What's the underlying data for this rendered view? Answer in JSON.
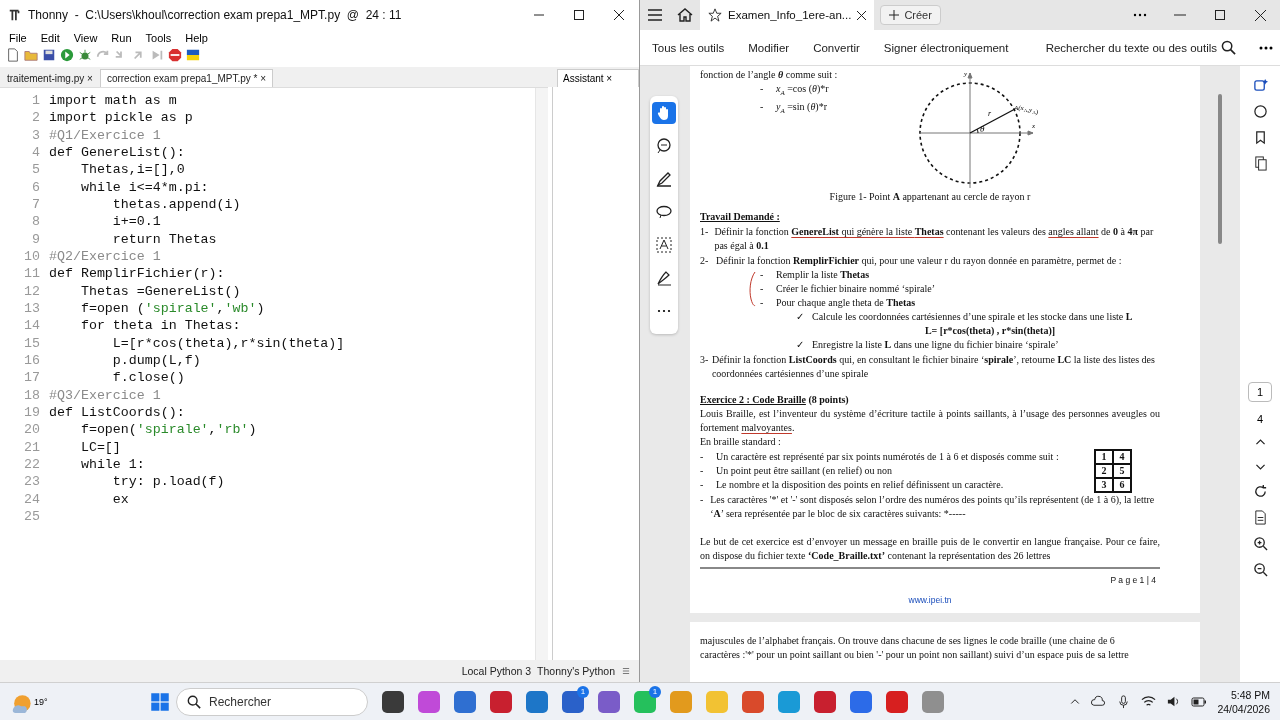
{
  "thonny": {
    "title": "Thonny  -  C:\\Users\\khoul\\correction exam prepa1_MPT.py  @  24 : 11",
    "menu": [
      "File",
      "Edit",
      "View",
      "Run",
      "Tools",
      "Help"
    ],
    "tabs": [
      {
        "label": "traitement-img.py",
        "close": "×",
        "selected": false
      },
      {
        "label": "correction exam prepa1_MPT.py *",
        "close": "×",
        "selected": true
      }
    ],
    "assistant_tab": {
      "label": "Assistant",
      "close": "×"
    },
    "code": [
      {
        "number": "1",
        "parts": [
          {
            "text": "import math as m",
            "kind": "plain"
          }
        ]
      },
      {
        "number": "2",
        "parts": [
          {
            "text": "import pickle as p",
            "kind": "plain"
          }
        ]
      },
      {
        "number": "3",
        "parts": [
          {
            "text": "#Q1/Exercice 1",
            "kind": "comment"
          }
        ]
      },
      {
        "number": "4",
        "parts": [
          {
            "text": "def GenereList():",
            "kind": "plain"
          }
        ]
      },
      {
        "number": "5",
        "parts": [
          {
            "text": "    Thetas,i=[],0",
            "kind": "plain"
          }
        ]
      },
      {
        "number": "6",
        "parts": [
          {
            "text": "    while i<=4*m.pi:",
            "kind": "plain"
          }
        ]
      },
      {
        "number": "7",
        "parts": [
          {
            "text": "        thetas.append(i)",
            "kind": "plain"
          }
        ]
      },
      {
        "number": "8",
        "parts": [
          {
            "text": "        i+=0.1",
            "kind": "plain"
          }
        ]
      },
      {
        "number": "9",
        "parts": [
          {
            "text": "        return Thetas",
            "kind": "plain"
          }
        ]
      },
      {
        "number": "10",
        "parts": [
          {
            "text": "#Q2/Exercice 1",
            "kind": "comment"
          }
        ]
      },
      {
        "number": "11",
        "parts": [
          {
            "text": "def RemplirFichier(r):",
            "kind": "plain"
          }
        ]
      },
      {
        "number": "12",
        "parts": [
          {
            "text": "    Thetas =GenereList()",
            "kind": "plain"
          }
        ]
      },
      {
        "number": "13",
        "parts": [
          {
            "text": "    f=open (",
            "kind": "plain"
          },
          {
            "text": "'spirale'",
            "kind": "string"
          },
          {
            "text": ",",
            "kind": "plain"
          },
          {
            "text": "'wb'",
            "kind": "string"
          },
          {
            "text": ")",
            "kind": "plain"
          }
        ]
      },
      {
        "number": "14",
        "parts": [
          {
            "text": "    for theta in Thetas:",
            "kind": "plain"
          }
        ]
      },
      {
        "number": "15",
        "parts": [
          {
            "text": "        L=[r*cos(theta),r*sin(theta)]",
            "kind": "plain"
          }
        ]
      },
      {
        "number": "16",
        "parts": [
          {
            "text": "        p.dump(L,f)",
            "kind": "plain"
          }
        ]
      },
      {
        "number": "17",
        "parts": [
          {
            "text": "        f.close()",
            "kind": "plain"
          }
        ]
      },
      {
        "number": "18",
        "parts": [
          {
            "text": "#Q3/Exercice 1",
            "kind": "comment"
          }
        ]
      },
      {
        "number": "19",
        "parts": [
          {
            "text": "def ListCoords():",
            "kind": "plain"
          }
        ]
      },
      {
        "number": "20",
        "parts": [
          {
            "text": "    f=open(",
            "kind": "plain"
          },
          {
            "text": "'spirale'",
            "kind": "string"
          },
          {
            "text": ",",
            "kind": "plain"
          },
          {
            "text": "'rb'",
            "kind": "string"
          },
          {
            "text": ")",
            "kind": "plain"
          }
        ]
      },
      {
        "number": "21",
        "parts": [
          {
            "text": "    LC=[]",
            "kind": "plain"
          }
        ]
      },
      {
        "number": "22",
        "parts": [
          {
            "text": "    while 1:",
            "kind": "plain"
          }
        ]
      },
      {
        "number": "23",
        "parts": [
          {
            "text": "        try: p.load(f)",
            "kind": "plain"
          }
        ]
      },
      {
        "number": "24",
        "parts": [
          {
            "text": "        ex",
            "kind": "plain"
          }
        ]
      },
      {
        "number": "25"
      }
    ],
    "status": [
      "Local Python 3",
      "Thonny's Python"
    ]
  },
  "reader": {
    "tab_title": "Examen_Info_1ere-an...",
    "create_button": "Créer",
    "tools": [
      "Tous les outils",
      "Modifier",
      "Convertir",
      "Signer électroniquement"
    ],
    "search": "Rechercher du texte ou des outils",
    "page": {
      "intro": [
        {
          "kind": "para",
          "parts": [
            {
              "text": "fonction de l’angle "
            },
            {
              "text": "θ",
              "kind": "bold-italic"
            },
            {
              "text": " comme suit :"
            }
          ]
        },
        {
          "kind": "sub-dash",
          "mark": "-",
          "parts": [
            {
              "text": "x",
              "kind": "italic"
            },
            {
              "text": "A",
              "kind": "sub"
            },
            {
              "text": " =cos ("
            },
            {
              "text": "θ",
              "kind": "italic"
            },
            {
              "text": ")*r"
            }
          ]
        },
        {
          "kind": "sub-dash",
          "mark": "-",
          "parts": [
            {
              "text": "y",
              "kind": "italic"
            },
            {
              "text": "A",
              "kind": "sub"
            },
            {
              "text": " =sin ("
            },
            {
              "text": "θ",
              "kind": "italic"
            },
            {
              "text": ")*r"
            }
          ]
        }
      ],
      "figure": {
        "y_axis": "y",
        "x_axis": "x",
        "radius": "r",
        "angle": "θ",
        "point": [
          {
            "text": "A(x",
            "kind": "italic"
          },
          {
            "text": "A",
            "kind": "sub"
          },
          {
            "text": ",y",
            "kind": "italic"
          },
          {
            "text": "A",
            "kind": "sub"
          },
          {
            "text": ")",
            "kind": "italic"
          }
        ],
        "caption": [
          {
            "text": "Figure 1- Point "
          },
          {
            "text": "A",
            "kind": "bold"
          },
          {
            "text": " appartenant au cercle de rayon r"
          }
        ]
      },
      "blocks": [
        {
          "kind": "heading",
          "parts": [
            {
              "text": "Travail Demandé :",
              "kind": "heading"
            }
          ]
        },
        {
          "kind": "numbered",
          "mark": "1-",
          "parts": [
            {
              "text": "Définir la fonction "
            },
            {
              "text": "GenereList",
              "kind": "bold-ink"
            },
            {
              "text": " qui génère la liste ",
              "kind": "ink"
            },
            {
              "text": "Thetas",
              "kind": "bold-ink"
            },
            {
              "text": " contenant les valeurs des "
            },
            {
              "text": "angles allant",
              "kind": "ink"
            },
            {
              "text": " de "
            },
            {
              "text": "0",
              "kind": "bold"
            },
            {
              "text": " à "
            },
            {
              "text": "4π",
              "kind": "bold"
            },
            {
              "text": " par pas égal à "
            },
            {
              "text": "0.1",
              "kind": "bold"
            }
          ]
        },
        {
          "kind": "numbered",
          "mark": "2-",
          "parts": [
            {
              "text": "Définir la fonction "
            },
            {
              "text": "RemplirFichier",
              "kind": "bold"
            },
            {
              "text": " qui, pour une valeur r du rayon donnée en paramètre, permet de :"
            }
          ]
        },
        {
          "kind": "sub-dash",
          "mark": "-",
          "parts": [
            {
              "text": "Remplir la liste "
            },
            {
              "text": "Thetas",
              "kind": "bold"
            }
          ]
        },
        {
          "kind": "sub-dash",
          "mark": "-",
          "parts": [
            {
              "text": "Créer le fichier binaire nommé ‘spirale’"
            }
          ]
        },
        {
          "kind": "sub-dash",
          "mark": "-",
          "parts": [
            {
              "text": "Pour chaque angle theta de "
            },
            {
              "text": "Thetas",
              "kind": "bold"
            }
          ]
        },
        {
          "kind": "check",
          "mark": "✓",
          "parts": [
            {
              "text": "Calcule les coordonnées cartésiennes d’une spirale et les stocke dans une liste "
            },
            {
              "text": "L",
              "kind": "bold"
            }
          ]
        },
        {
          "kind": "formula",
          "parts": [
            {
              "text": "L= [r*cos(theta) , r*sin(theta)]",
              "kind": "bold"
            }
          ]
        },
        {
          "kind": "check",
          "mark": "✓",
          "parts": [
            {
              "text": "Enregistre la liste "
            },
            {
              "text": "L",
              "kind": "bold"
            },
            {
              "text": " dans une ligne du fichier binaire ‘spirale’"
            }
          ]
        },
        {
          "kind": "numbered",
          "mark": "3-",
          "parts": [
            {
              "text": "Définir la fonction "
            },
            {
              "text": "ListCoords",
              "kind": "bold"
            },
            {
              "text": " qui, en consultant le fichier binaire ‘"
            },
            {
              "text": "spirale",
              "kind": "bold"
            },
            {
              "text": "’, retourne "
            },
            {
              "text": "LC",
              "kind": "bold"
            },
            {
              "text": " la liste des listes des coordonnées cartésiennes d’une spirale"
            }
          ]
        },
        {
          "kind": "heading",
          "parts": [
            {
              "text": "Exercice 2 : Code Braille",
              "kind": "heading"
            },
            {
              "text": " (8 points)",
              "kind": "bold"
            }
          ]
        },
        {
          "kind": "para",
          "parts": [
            {
              "text": "Louis Braille, est l’inventeur du système d’écriture tactile à points saillants, à l’usage des personnes aveugles ou fortement "
            },
            {
              "text": "malvoyantes",
              "kind": "ink"
            },
            {
              "text": "."
            }
          ]
        },
        {
          "kind": "para",
          "parts": [
            {
              "text": "En braille standard :"
            }
          ]
        },
        {
          "kind": "grid-list",
          "grid": [
            "1",
            "4",
            "2",
            "5",
            "3",
            "6"
          ],
          "items": [
            {
              "mark": "-",
              "parts": [
                {
                  "text": "Un caractère est représenté par six points numérotés de 1 à 6 et disposés comme suit :"
                }
              ]
            },
            {
              "mark": "-",
              "parts": [
                {
                  "text": "Un point peut être saillant (en relief) ou non"
                }
              ]
            },
            {
              "mark": "-",
              "parts": [
                {
                  "text": "Le nombre et la disposition des points en relief définissent un caractère."
                }
              ]
            }
          ]
        },
        {
          "kind": "dash",
          "mark": "-",
          "parts": [
            {
              "text": "Les caractères '*' et '-' sont disposés selon l’ordre des numéros des points qu’ils représentent (de 1 à 6), la lettre ‘"
            },
            {
              "text": "A",
              "kind": "bold"
            },
            {
              "text": "’ sera représentée par le bloc de six caractères suivants: *-----"
            }
          ]
        },
        {
          "kind": "lead",
          "parts": [
            {
              "text": "Le but de cet exercice est d’envoyer un message en braille puis de le convertir en langue française. Pour ce faire, on dispose du fichier texte "
            },
            {
              "text": "‘Code_Braille.txt’",
              "kind": "bold"
            },
            {
              "text": " contenant la représentation des 26 lettres"
            }
          ]
        }
      ],
      "footer_page": "P a g e  1 | 4",
      "footer_site": "www.ipei.tn"
    },
    "next_page": [
      "majuscules de l’alphabet français. On trouve dans chacune de ses lignes le code braille (une chaine de 6",
      "caractères :'*' pour un point saillant ou bien '-' pour un point non saillant) suivi d’un espace puis de sa lettre"
    ],
    "page_number": "1",
    "page_count": "4"
  },
  "taskbar": {
    "weather": "19°",
    "search": "Rechercher",
    "apps": [
      {
        "color": "#3a3a3a"
      },
      {
        "color": "#c04ad8"
      },
      {
        "color": "#2f6fd1"
      },
      {
        "color": "#c8202f"
      },
      {
        "color": "#1d76c8"
      },
      {
        "color": "#2a61c9",
        "badge": "1"
      },
      {
        "color": "#7a5cc8"
      },
      {
        "color": "#25c05c",
        "badge": "1"
      },
      {
        "color": "#e29a1d"
      },
      {
        "color": "#f2c233"
      },
      {
        "color": "#d94a2b"
      },
      {
        "color": "#1a9ad6"
      },
      {
        "color": "#c8202f"
      },
      {
        "color": "#2c6be8"
      },
      {
        "color": "#d71f1f"
      },
      {
        "color": "#8f8f8f"
      }
    ],
    "time": "5:48 PM",
    "date": "24/04/2026"
  }
}
